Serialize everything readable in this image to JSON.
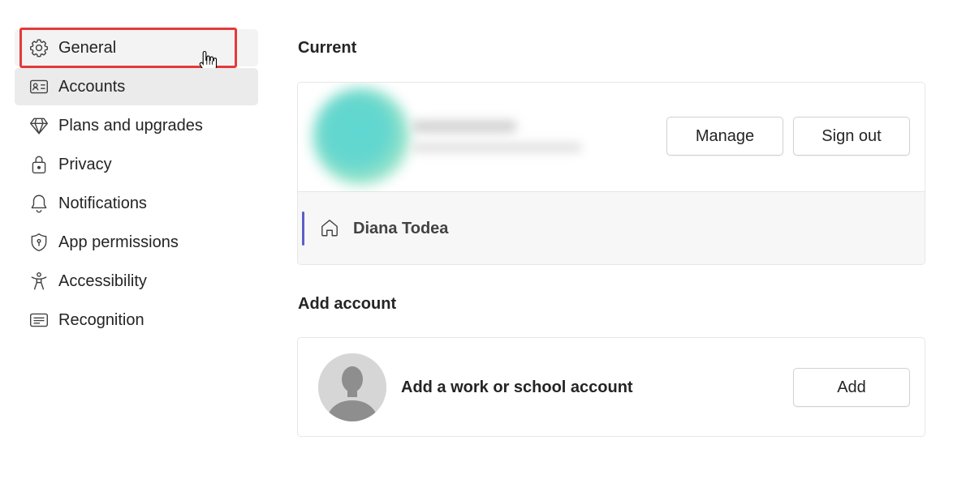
{
  "sidebar": {
    "items": [
      {
        "label": "General",
        "icon": "gear-icon"
      },
      {
        "label": "Accounts",
        "icon": "id-card-icon"
      },
      {
        "label": "Plans and upgrades",
        "icon": "diamond-icon"
      },
      {
        "label": "Privacy",
        "icon": "lock-icon"
      },
      {
        "label": "Notifications",
        "icon": "bell-icon"
      },
      {
        "label": "App permissions",
        "icon": "shield-icon"
      },
      {
        "label": "Accessibility",
        "icon": "accessibility-icon"
      },
      {
        "label": "Recognition",
        "icon": "recognition-icon"
      }
    ]
  },
  "main": {
    "current_title": "Current",
    "current_account": {
      "manage_label": "Manage",
      "signout_label": "Sign out",
      "org_name": "Diana Todea"
    },
    "add_title": "Add account",
    "add_account": {
      "text": "Add a work or school account",
      "button_label": "Add"
    }
  },
  "colors": {
    "accent": "#5b5fc7",
    "highlight": "#e23b3b",
    "selected_bg": "#ebebeb"
  }
}
